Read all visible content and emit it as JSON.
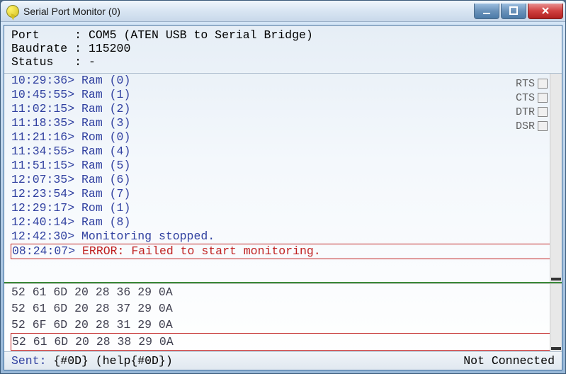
{
  "window": {
    "title": "Serial Port Monitor (0)"
  },
  "info": {
    "port_label": "Port     ",
    "port_value": "COM5 (ATEN USB to Serial Bridge)",
    "baud_label": "Baudrate ",
    "baud_value": "115200",
    "status_label": "Status   ",
    "status_value": "-"
  },
  "signals": {
    "rts": "RTS",
    "cts": "CTS",
    "dtr": "DTR",
    "dsr": "DSR"
  },
  "log": [
    {
      "ts": "10:29:36",
      "msg": "Ram (0)"
    },
    {
      "ts": "10:45:55",
      "msg": "Ram (1)"
    },
    {
      "ts": "11:02:15",
      "msg": "Ram (2)"
    },
    {
      "ts": "11:18:35",
      "msg": "Ram (3)"
    },
    {
      "ts": "11:21:16",
      "msg": "Rom (0)"
    },
    {
      "ts": "11:34:55",
      "msg": "Ram (4)"
    },
    {
      "ts": "11:51:15",
      "msg": "Ram (5)"
    },
    {
      "ts": "12:07:35",
      "msg": "Ram (6)"
    },
    {
      "ts": "12:23:54",
      "msg": "Ram (7)"
    },
    {
      "ts": "12:29:17",
      "msg": "Rom (1)"
    },
    {
      "ts": "12:40:14",
      "msg": "Ram (8)"
    },
    {
      "ts": "12:42:30",
      "msg": "Monitoring stopped.",
      "kind": "stopped"
    },
    {
      "ts": "08:24:07",
      "msg": "ERROR: Failed to start monitoring.",
      "kind": "error"
    }
  ],
  "hex": [
    {
      "bytes": "52 61 6D 20 28 36 29 0A"
    },
    {
      "bytes": "52 61 6D 20 28 37 29 0A"
    },
    {
      "bytes": "52 6F 6D 20 28 31 29 0A"
    },
    {
      "bytes": "52 61 6D 20 28 38 29 0A",
      "boxed": true
    }
  ],
  "status": {
    "sent_label": "Sent:",
    "sent_value": "{#0D} (help{#0D})",
    "right": "Not Connected"
  },
  "collapse_glyph": "<"
}
